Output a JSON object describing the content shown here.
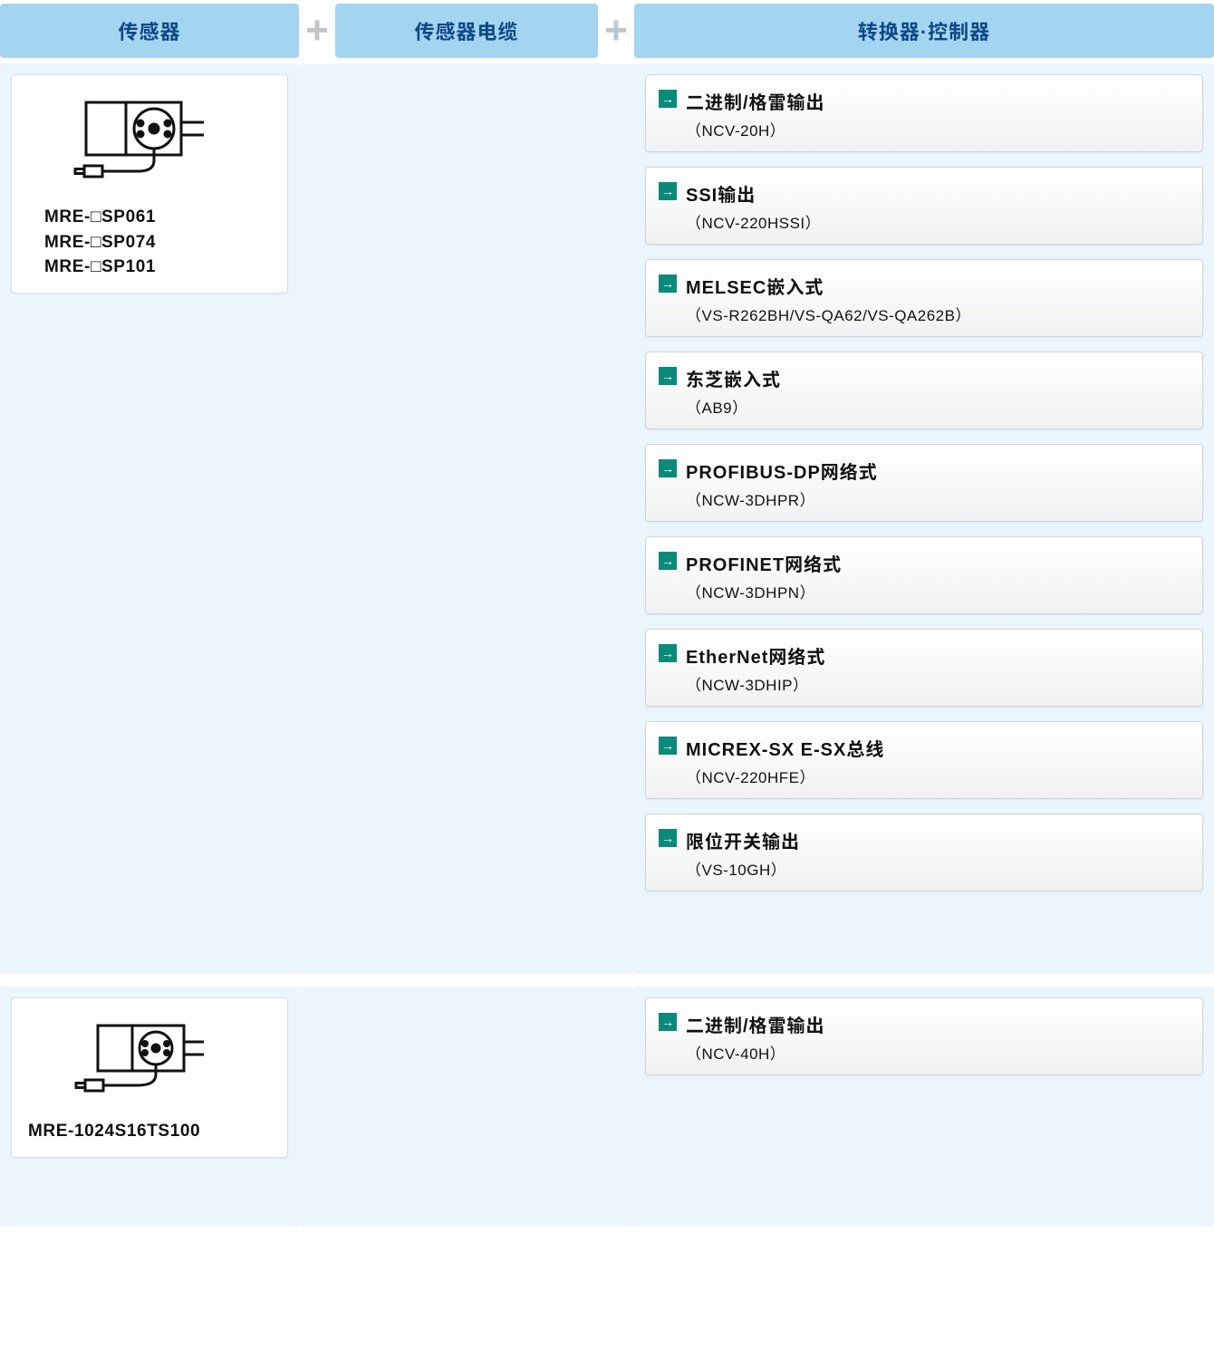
{
  "headers": {
    "sensor": "传感器",
    "cable": "传感器电缆",
    "converter": "转换器·控制器"
  },
  "section1": {
    "sensor_models": [
      "MRE-□SP061",
      "MRE-□SP074",
      "MRE-□SP101"
    ],
    "converters": [
      {
        "title": "二进制/格雷输出",
        "sub": "（NCV-20H）"
      },
      {
        "title": "SSI输出",
        "sub": "（NCV-220HSSI）"
      },
      {
        "title": "MELSEC嵌入式",
        "sub": "（VS-R262BH/VS-QA62/VS-QA262B）"
      },
      {
        "title": "东芝嵌入式",
        "sub": "（AB9）"
      },
      {
        "title": "PROFIBUS-DP网络式",
        "sub": "（NCW-3DHPR）"
      },
      {
        "title": "PROFINET网络式",
        "sub": "（NCW-3DHPN）"
      },
      {
        "title": "EtherNet网络式",
        "sub": "（NCW-3DHIP）"
      },
      {
        "title": "MICREX-SX E-SX总线",
        "sub": "（NCV-220HFE）"
      },
      {
        "title": "限位开关输出",
        "sub": "（VS-10GH）"
      }
    ]
  },
  "section2": {
    "sensor_models": [
      "MRE-1024S16TS100"
    ],
    "converters": [
      {
        "title": "二进制/格雷输出",
        "sub": "（NCV-40H）"
      }
    ]
  }
}
